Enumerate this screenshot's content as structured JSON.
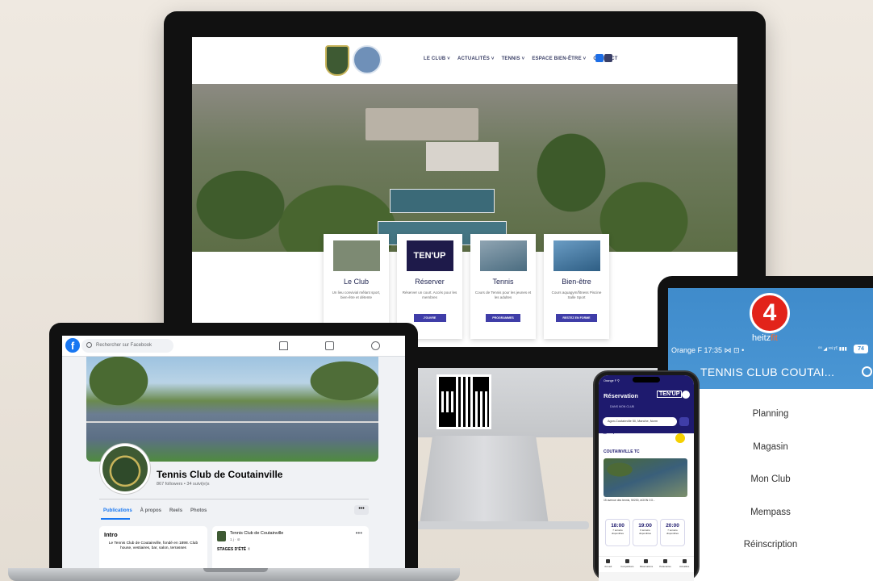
{
  "website": {
    "nav": [
      "LE CLUB ˅",
      "ACTUALITÉS ˅",
      "TENNIS ˅",
      "ESPACE BIEN-ÊTRE ˅",
      "CONTACT"
    ],
    "cards": [
      {
        "title": "Le Club",
        "desc": "Un lieu convivial mêlant sport, bien-être et détente",
        "button": "",
        "thumb_color": "#7d8a73"
      },
      {
        "title": "Réserver",
        "desc": "Réserver un court. Accès pour les membres",
        "button": "J'OUVRE",
        "thumb_color": "#1e1a4a"
      },
      {
        "title": "Tennis",
        "desc": "Cours de Tennis pour les jeunes et les adultes",
        "button": "PROGRAMMES",
        "thumb_color": "#6b7f8f"
      },
      {
        "title": "Bien-être",
        "desc": "Cours aquagym/fitness Piscine Salle Sport",
        "button": "RESTEZ EN FORME",
        "thumb_color": "#4a78a0"
      }
    ],
    "tenup_label": "TEN'UP"
  },
  "facebook": {
    "search_placeholder": "Rechercher sur Facebook",
    "page_name": "Tennis Club de Coutainville",
    "followers": "867 followers • 34 suivi(e)s",
    "tabs": [
      "Publications",
      "À propos",
      "Reels",
      "Photos"
    ],
    "more": "•••",
    "intro_title": "Intro",
    "intro_text": "Le Tennis Club de Coutainville, fondé en 1898. Club house, vestiaires, bar, salon, terrasses",
    "post_author": "Tennis Club de Coutainville",
    "post_meta": "1 j · ⊘",
    "post_text": "STAGES D'ÉTÉ ✌"
  },
  "tablet": {
    "logo_number": "4",
    "logo_text_a": "heitz",
    "logo_text_b": "fit",
    "carrier": "Orange F 17:35 ⋈ ⊡ •",
    "signal": "⁰⁰ ◢ ᵛᵒᴸᴛᴱ ▮▮▮",
    "battery": "74",
    "title": "TENNIS CLUB COUTAI...",
    "menu": [
      "Planning",
      "Magasin",
      "Mon Club",
      "Mempass",
      "Réinscription"
    ]
  },
  "phone": {
    "carrier": "Orange F ⚲",
    "title": "Réservation",
    "tenup": "TEN'UP",
    "sub": "DANS MON CLUB",
    "search": "Agon-Coutainville 50, Manche, Norm",
    "date": "▦ Aujourd'hui ˅",
    "club": "COUTAINVILLE TC",
    "address": "15 avenue des tennis, 50230, AGON CO...",
    "slots": [
      {
        "time": "18:00",
        "sub1": "7 terrains",
        "sub2": "disponibles"
      },
      {
        "time": "19:00",
        "sub1": "6 terrains",
        "sub2": "disponibles"
      },
      {
        "time": "20:00",
        "sub1": "7 terrains",
        "sub2": "disponibles"
      }
    ],
    "tabs": [
      "Accueil",
      "Compétitions",
      "Réservations",
      "Partenaires",
      "Actualités"
    ]
  }
}
